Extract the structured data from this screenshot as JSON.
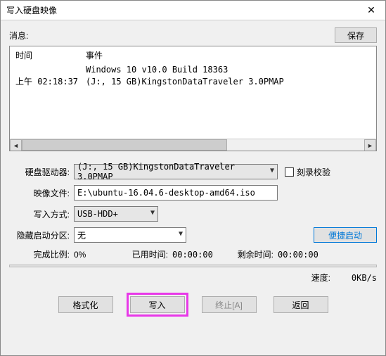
{
  "window": {
    "title": "写入硬盘映像"
  },
  "messageArea": {
    "label": "消息:",
    "saveButton": "保存"
  },
  "log": {
    "header": {
      "time": "时间",
      "event": "事件"
    },
    "lines": [
      {
        "time": "",
        "event": "Windows 10 v10.0 Build 18363"
      },
      {
        "time": "上午 02:18:37",
        "event": "(J:, 15 GB)KingstonDataTraveler 3.0PMAP"
      }
    ]
  },
  "form": {
    "driveLabel": "硬盘驱动器:",
    "driveValue": "(J:, 15 GB)KingstonDataTraveler 3.0PMAP",
    "verifyLabel": "刻录校验",
    "imageLabel": "映像文件:",
    "imageValue": "E:\\ubuntu-16.04.6-desktop-amd64.iso",
    "writeModeLabel": "写入方式:",
    "writeModeValue": "USB-HDD+",
    "hiddenBootLabel": "隐藏启动分区:",
    "hiddenBootValue": "无",
    "convenientBoot": "便捷启动"
  },
  "progress": {
    "completeLabel": "完成比例:",
    "completeValue": "0%",
    "elapsedLabel": "已用时间:",
    "elapsedValue": "00:00:00",
    "remainLabel": "剩余时间:",
    "remainValue": "00:00:00",
    "speedLabel": "速度:",
    "speedValue": "0KB/s"
  },
  "buttons": {
    "format": "格式化",
    "write": "写入",
    "abort": "终止[A]",
    "back": "返回"
  }
}
